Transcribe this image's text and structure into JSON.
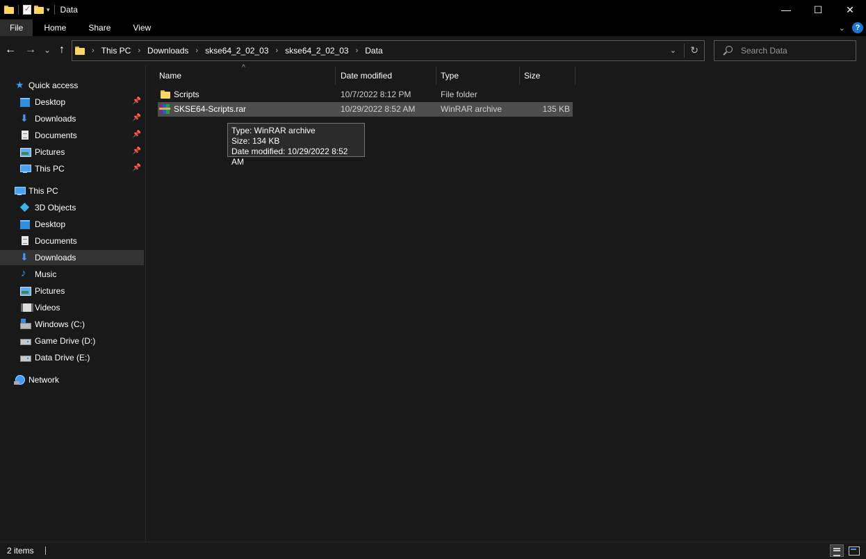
{
  "window": {
    "title": "Data",
    "minimize": "—",
    "maximize": "☐",
    "close": "✕"
  },
  "ribbon": {
    "tabs": [
      "File",
      "Home",
      "Share",
      "View"
    ]
  },
  "nav": {
    "back": "←",
    "forward": "→",
    "recent": "⌄",
    "up": "↑",
    "breadcrumb": [
      "This PC",
      "Downloads",
      "skse64_2_02_03",
      "skse64_2_02_03",
      "Data"
    ],
    "refresh": "↻"
  },
  "search": {
    "placeholder": "Search Data"
  },
  "sidebar": {
    "quick_access": {
      "label": "Quick access",
      "items": [
        {
          "label": "Desktop",
          "icon": "desktop-icon"
        },
        {
          "label": "Downloads",
          "icon": "download-icon"
        },
        {
          "label": "Documents",
          "icon": "documents-icon"
        },
        {
          "label": "Pictures",
          "icon": "pictures-icon"
        },
        {
          "label": "This PC",
          "icon": "this-pc-icon"
        }
      ]
    },
    "this_pc": {
      "label": "This PC",
      "items": [
        {
          "label": "3D Objects",
          "icon": "3d-objects-icon"
        },
        {
          "label": "Desktop",
          "icon": "desktop-icon"
        },
        {
          "label": "Documents",
          "icon": "documents-icon"
        },
        {
          "label": "Downloads",
          "icon": "download-icon",
          "selected": true
        },
        {
          "label": "Music",
          "icon": "music-icon"
        },
        {
          "label": "Pictures",
          "icon": "pictures-icon"
        },
        {
          "label": "Videos",
          "icon": "videos-icon"
        },
        {
          "label": "Windows (C:)",
          "icon": "windows-drive-icon"
        },
        {
          "label": "Game Drive (D:)",
          "icon": "drive-icon"
        },
        {
          "label": "Data Drive (E:)",
          "icon": "drive-icon"
        }
      ]
    },
    "network": {
      "label": "Network",
      "icon": "network-icon"
    }
  },
  "columns": {
    "name": "Name",
    "date_modified": "Date modified",
    "type": "Type",
    "size": "Size"
  },
  "files": [
    {
      "name": "Scripts",
      "date": "10/7/2022 8:12 PM",
      "type": "File folder",
      "size": "",
      "icon": "folder-icon"
    },
    {
      "name": "SKSE64-Scripts.rar",
      "date": "10/29/2022 8:52 AM",
      "type": "WinRAR archive",
      "size": "135 KB",
      "icon": "winrar-icon",
      "selected": true
    }
  ],
  "tooltip": {
    "line1": "Type: WinRAR archive",
    "line2": "Size: 134 KB",
    "line3": "Date modified: 10/29/2022 8:52 AM"
  },
  "status": {
    "item_count": "2 items"
  }
}
